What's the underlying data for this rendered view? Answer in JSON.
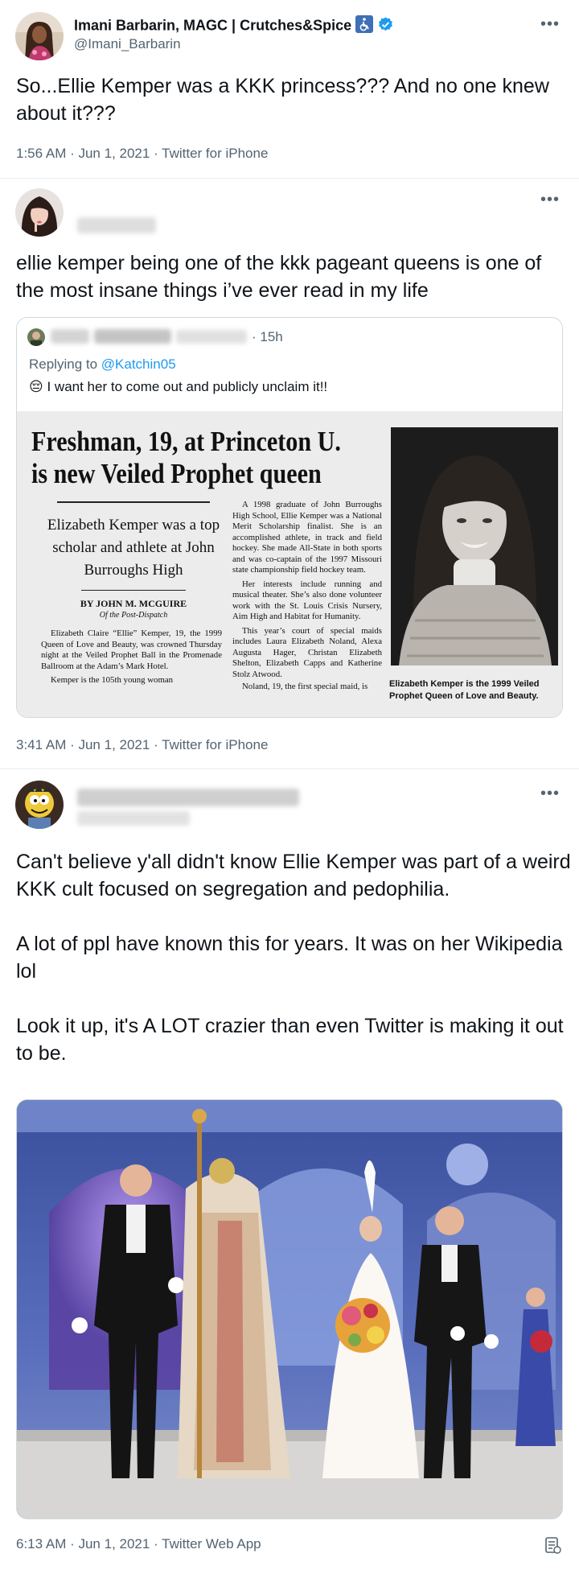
{
  "tweets": [
    {
      "author_name": "Imani Barbarin, MAGC | Crutches&Spice",
      "author_handle": "@Imani_Barbarin",
      "text": "So...Ellie Kemper was a KKK princess??? And no one knew about it???",
      "meta": "1:56 AM · Jun 1, 2021 · Twitter for iPhone"
    },
    {
      "text": "ellie kemper being one of the kkk pageant queens is one of the most insane things i’ve ever read in my life",
      "meta": "3:41 AM · Jun 1, 2021 · Twitter for iPhone",
      "quote": {
        "time": "· 15h",
        "reply_prefix": "Replying to ",
        "reply_handle": "@Katchin05",
        "emoji": "😔",
        "text": "I want her to come out and publicly unclaim it!!",
        "clipping": {
          "headline_1": "Freshman, 19, at Princeton U.",
          "headline_2": "is new Veiled Prophet queen",
          "subhead": "Elizabeth Kemper was a top scholar and athlete at John Burroughs High",
          "byline": "BY JOHN M. MCGUIRE",
          "byline_sub": "Of the Post-Dispatch",
          "col1": "Elizabeth Claire “Ellie” Kemper, 19, the 1999 Queen of Love and Beauty, was crowned Thursday night at the Veiled Prophet Ball in the Promenade Ballroom at the Adam’s Mark Hotel.",
          "col1b": "Kemper is the 105th young woman",
          "col2a": "A 1998 graduate of John Burroughs High School, Ellie Kemper was a National Merit Scholarship finalist. She is an accomplished athlete, in track and field hockey. She made All-State in both sports and was co-captain of the 1997 Missouri state championship field hockey team.",
          "col2b": "Her interests include running and musical theater. She’s also done volunteer work with the St. Louis Crisis Nursery, Aim High and Habitat for Humanity.",
          "col2c": "This year’s court of special maids includes Laura Elizabeth Noland, Alexa Augusta Hager, Christan Elizabeth Shelton, Elizabeth Capps and Katherine Stolz Atwood.",
          "col2d": "Noland, 19, the first special maid, is",
          "caption": "Elizabeth Kemper is the 1999 Veiled Prophet Queen of Love and Beauty."
        }
      }
    },
    {
      "text_p1": "Can't believe y'all didn't know Ellie Kemper was part of a weird KKK cult focused on segregation and pedophilia.",
      "text_p2": "A lot of ppl have known this for years. It was on her Wikipedia lol",
      "text_p3": "Look it up, it's A LOT crazier than even Twitter is making it out to be.",
      "meta": "6:13 AM · Jun 1, 2021 · Twitter Web App"
    }
  ],
  "icons": {
    "more": "more-options-icon",
    "wheelchair": "wheelchair-icon",
    "verified": "verified-badge-icon",
    "source": "analytics-icon"
  },
  "colors": {
    "link": "#1d9bf0",
    "secondary_text": "#536471",
    "border": "#e6ecf0"
  }
}
